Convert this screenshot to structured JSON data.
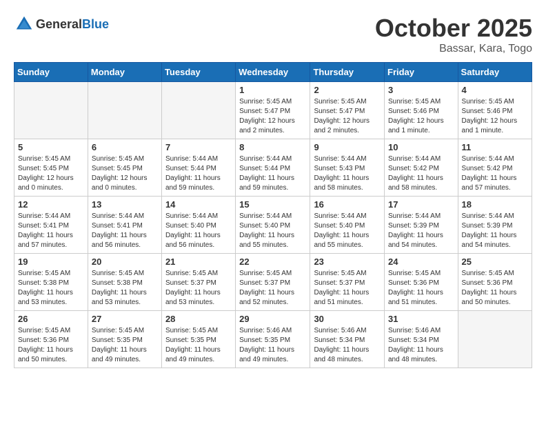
{
  "header": {
    "logo_general": "General",
    "logo_blue": "Blue",
    "month": "October 2025",
    "location": "Bassar, Kara, Togo"
  },
  "days_of_week": [
    "Sunday",
    "Monday",
    "Tuesday",
    "Wednesday",
    "Thursday",
    "Friday",
    "Saturday"
  ],
  "weeks": [
    [
      {
        "day": "",
        "info": ""
      },
      {
        "day": "",
        "info": ""
      },
      {
        "day": "",
        "info": ""
      },
      {
        "day": "1",
        "info": "Sunrise: 5:45 AM\nSunset: 5:47 PM\nDaylight: 12 hours and 2 minutes."
      },
      {
        "day": "2",
        "info": "Sunrise: 5:45 AM\nSunset: 5:47 PM\nDaylight: 12 hours and 2 minutes."
      },
      {
        "day": "3",
        "info": "Sunrise: 5:45 AM\nSunset: 5:46 PM\nDaylight: 12 hours and 1 minute."
      },
      {
        "day": "4",
        "info": "Sunrise: 5:45 AM\nSunset: 5:46 PM\nDaylight: 12 hours and 1 minute."
      }
    ],
    [
      {
        "day": "5",
        "info": "Sunrise: 5:45 AM\nSunset: 5:45 PM\nDaylight: 12 hours and 0 minutes."
      },
      {
        "day": "6",
        "info": "Sunrise: 5:45 AM\nSunset: 5:45 PM\nDaylight: 12 hours and 0 minutes."
      },
      {
        "day": "7",
        "info": "Sunrise: 5:44 AM\nSunset: 5:44 PM\nDaylight: 11 hours and 59 minutes."
      },
      {
        "day": "8",
        "info": "Sunrise: 5:44 AM\nSunset: 5:44 PM\nDaylight: 11 hours and 59 minutes."
      },
      {
        "day": "9",
        "info": "Sunrise: 5:44 AM\nSunset: 5:43 PM\nDaylight: 11 hours and 58 minutes."
      },
      {
        "day": "10",
        "info": "Sunrise: 5:44 AM\nSunset: 5:42 PM\nDaylight: 11 hours and 58 minutes."
      },
      {
        "day": "11",
        "info": "Sunrise: 5:44 AM\nSunset: 5:42 PM\nDaylight: 11 hours and 57 minutes."
      }
    ],
    [
      {
        "day": "12",
        "info": "Sunrise: 5:44 AM\nSunset: 5:41 PM\nDaylight: 11 hours and 57 minutes."
      },
      {
        "day": "13",
        "info": "Sunrise: 5:44 AM\nSunset: 5:41 PM\nDaylight: 11 hours and 56 minutes."
      },
      {
        "day": "14",
        "info": "Sunrise: 5:44 AM\nSunset: 5:40 PM\nDaylight: 11 hours and 56 minutes."
      },
      {
        "day": "15",
        "info": "Sunrise: 5:44 AM\nSunset: 5:40 PM\nDaylight: 11 hours and 55 minutes."
      },
      {
        "day": "16",
        "info": "Sunrise: 5:44 AM\nSunset: 5:40 PM\nDaylight: 11 hours and 55 minutes."
      },
      {
        "day": "17",
        "info": "Sunrise: 5:44 AM\nSunset: 5:39 PM\nDaylight: 11 hours and 54 minutes."
      },
      {
        "day": "18",
        "info": "Sunrise: 5:44 AM\nSunset: 5:39 PM\nDaylight: 11 hours and 54 minutes."
      }
    ],
    [
      {
        "day": "19",
        "info": "Sunrise: 5:45 AM\nSunset: 5:38 PM\nDaylight: 11 hours and 53 minutes."
      },
      {
        "day": "20",
        "info": "Sunrise: 5:45 AM\nSunset: 5:38 PM\nDaylight: 11 hours and 53 minutes."
      },
      {
        "day": "21",
        "info": "Sunrise: 5:45 AM\nSunset: 5:37 PM\nDaylight: 11 hours and 53 minutes."
      },
      {
        "day": "22",
        "info": "Sunrise: 5:45 AM\nSunset: 5:37 PM\nDaylight: 11 hours and 52 minutes."
      },
      {
        "day": "23",
        "info": "Sunrise: 5:45 AM\nSunset: 5:37 PM\nDaylight: 11 hours and 51 minutes."
      },
      {
        "day": "24",
        "info": "Sunrise: 5:45 AM\nSunset: 5:36 PM\nDaylight: 11 hours and 51 minutes."
      },
      {
        "day": "25",
        "info": "Sunrise: 5:45 AM\nSunset: 5:36 PM\nDaylight: 11 hours and 50 minutes."
      }
    ],
    [
      {
        "day": "26",
        "info": "Sunrise: 5:45 AM\nSunset: 5:36 PM\nDaylight: 11 hours and 50 minutes."
      },
      {
        "day": "27",
        "info": "Sunrise: 5:45 AM\nSunset: 5:35 PM\nDaylight: 11 hours and 49 minutes."
      },
      {
        "day": "28",
        "info": "Sunrise: 5:45 AM\nSunset: 5:35 PM\nDaylight: 11 hours and 49 minutes."
      },
      {
        "day": "29",
        "info": "Sunrise: 5:46 AM\nSunset: 5:35 PM\nDaylight: 11 hours and 49 minutes."
      },
      {
        "day": "30",
        "info": "Sunrise: 5:46 AM\nSunset: 5:34 PM\nDaylight: 11 hours and 48 minutes."
      },
      {
        "day": "31",
        "info": "Sunrise: 5:46 AM\nSunset: 5:34 PM\nDaylight: 11 hours and 48 minutes."
      },
      {
        "day": "",
        "info": ""
      }
    ]
  ]
}
